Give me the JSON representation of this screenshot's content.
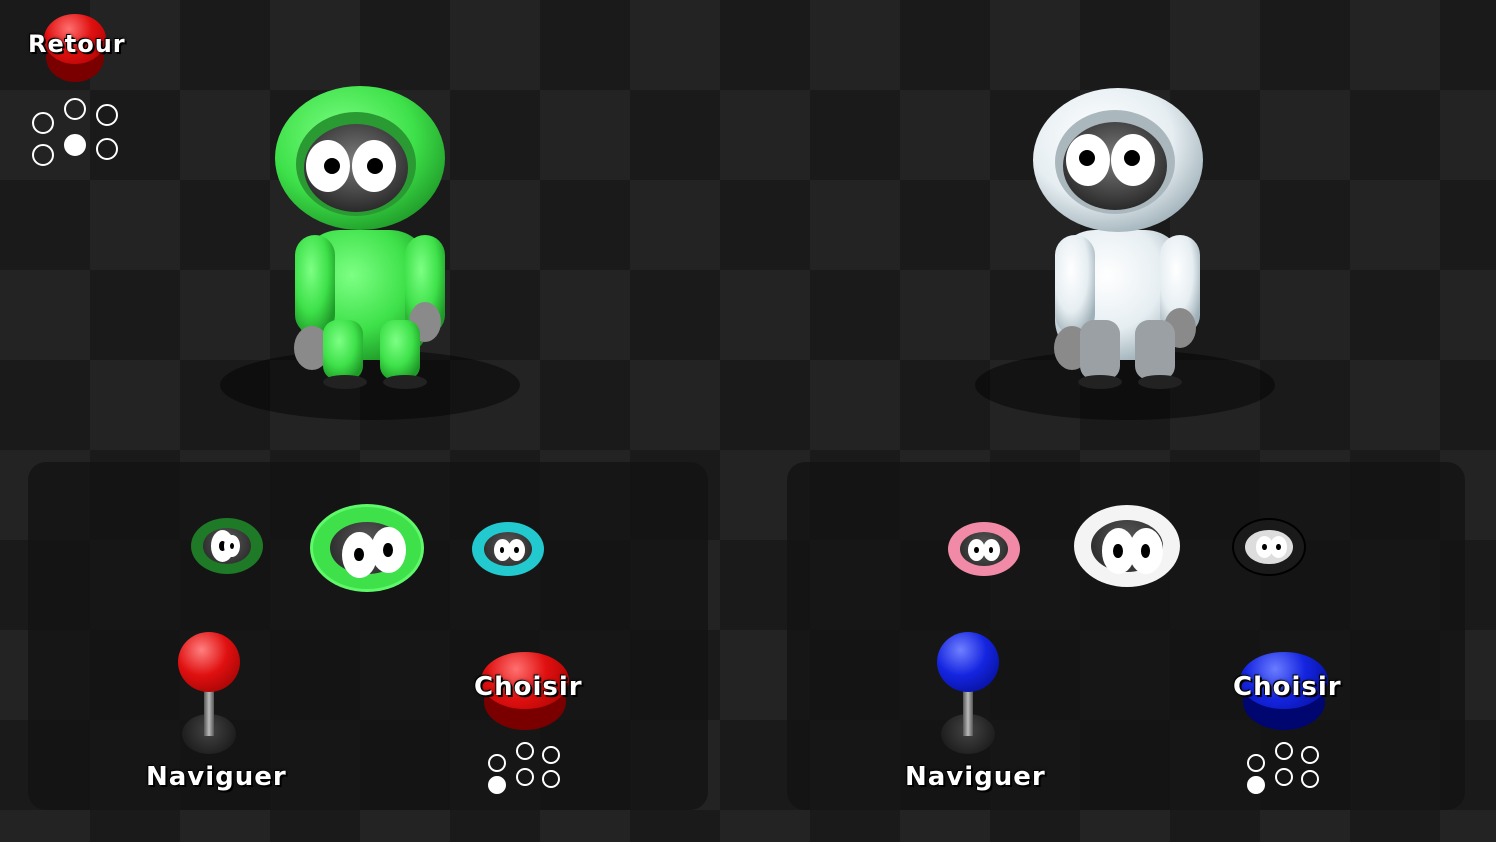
{
  "back_button": {
    "label": "Retour",
    "color": "#e01010"
  },
  "players": [
    {
      "character_color": "#3ee14a",
      "skins": [
        {
          "color": "#1e7a26",
          "selected": false
        },
        {
          "color": "#3ee14a",
          "selected": true
        },
        {
          "color": "#22c9cf",
          "selected": false
        }
      ],
      "navigate_label": "Naviguer",
      "choose_label": "Choisir",
      "controller_color": "red"
    },
    {
      "character_color": "#e6eef2",
      "skins": [
        {
          "color": "#f08aa6",
          "selected": false
        },
        {
          "color": "#f4f4f4",
          "selected": true
        },
        {
          "color": "#1a1a1a",
          "selected": false
        }
      ],
      "navigate_label": "Naviguer",
      "choose_label": "Choisir",
      "controller_color": "blue"
    }
  ],
  "icons": [
    "arcade-button-icon",
    "joystick-icon",
    "button-layout-icon",
    "character-face-icon"
  ]
}
